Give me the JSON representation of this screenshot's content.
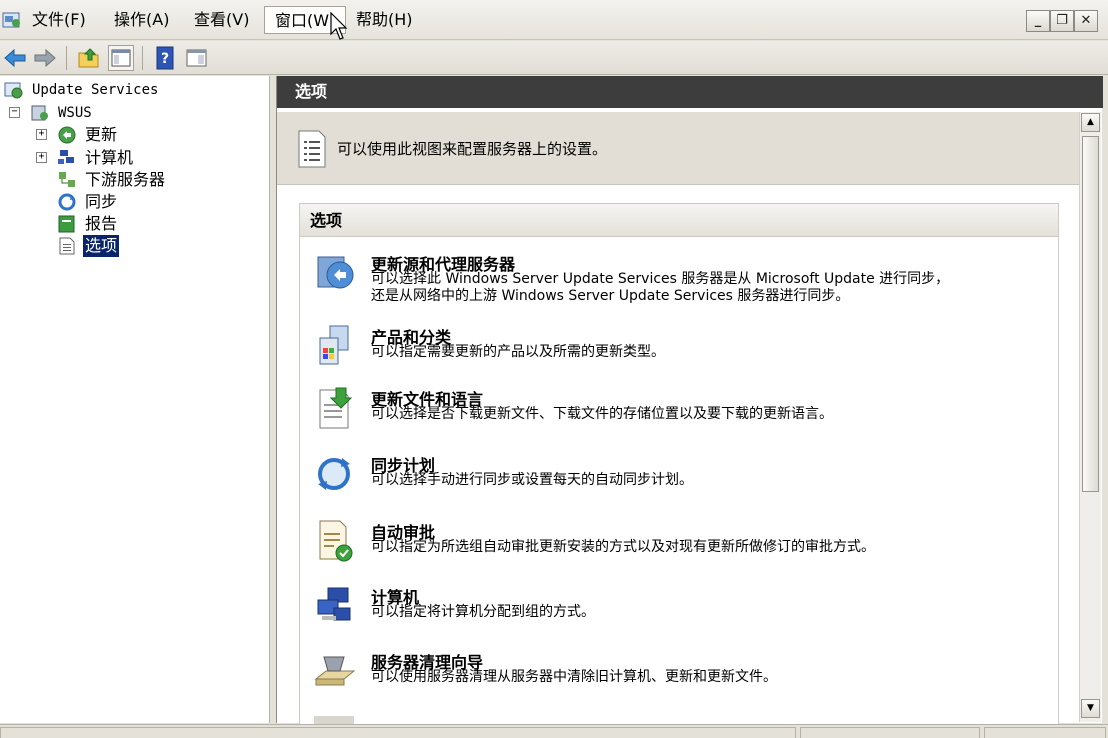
{
  "menu": {
    "items": [
      "文件(F)",
      "操作(A)",
      "查看(V)",
      "窗口(W)",
      "帮助(H)"
    ],
    "active_index": 3
  },
  "window_buttons": {
    "minimize": "_",
    "restore": "❐",
    "close": "✕"
  },
  "toolbar": {
    "buttons": [
      "back",
      "forward",
      "up-folder",
      "show-hide-tree",
      "help",
      "show-hide-action-pane"
    ]
  },
  "tree": {
    "root": "Update Services",
    "server": "WSUS",
    "children": [
      "更新",
      "计算机",
      "下游服务器",
      "同步",
      "报告",
      "选项"
    ],
    "selected": "选项"
  },
  "right_pane": {
    "header": "选项",
    "description": "可以使用此视图来配置服务器上的设置。",
    "options_title": "选项",
    "options": [
      {
        "title": "更新源和代理服务器",
        "desc_line1": "可以选择此 Windows Server Update Services 服务器是从 Microsoft Update 进行同步，",
        "desc_line2": "还是从网络中的上游 Windows Server Update Services 服务器进行同步。",
        "icon": "update-source-icon"
      },
      {
        "title": "产品和分类",
        "desc_line1": "可以指定需要更新的产品以及所需的更新类型。",
        "icon": "products-classifications-icon"
      },
      {
        "title": "更新文件和语言",
        "desc_line1": "可以选择是否下载更新文件、下载文件的存储位置以及要下载的更新语言。",
        "icon": "update-files-icon"
      },
      {
        "title": "同步计划",
        "desc_line1": "可以选择手动进行同步或设置每天的自动同步计划。",
        "icon": "sync-schedule-icon"
      },
      {
        "title": "自动审批",
        "desc_line1": "可以指定为所选组自动审批更新安装的方式以及对现有更新所做修订的审批方式。",
        "icon": "auto-approval-icon"
      },
      {
        "title": "计算机",
        "desc_line1": "可以指定将计算机分配到组的方式。",
        "icon": "computers-icon"
      },
      {
        "title": "服务器清理向导",
        "desc_line1": "可以使用服务器清理从服务器中清除旧计算机、更新和更新文件。",
        "icon": "cleanup-wizard-icon"
      }
    ]
  },
  "colors": {
    "header_bg": "#3d3d3d",
    "selection_bg": "#0a246a",
    "chrome_bg": "#e4e1d9"
  }
}
